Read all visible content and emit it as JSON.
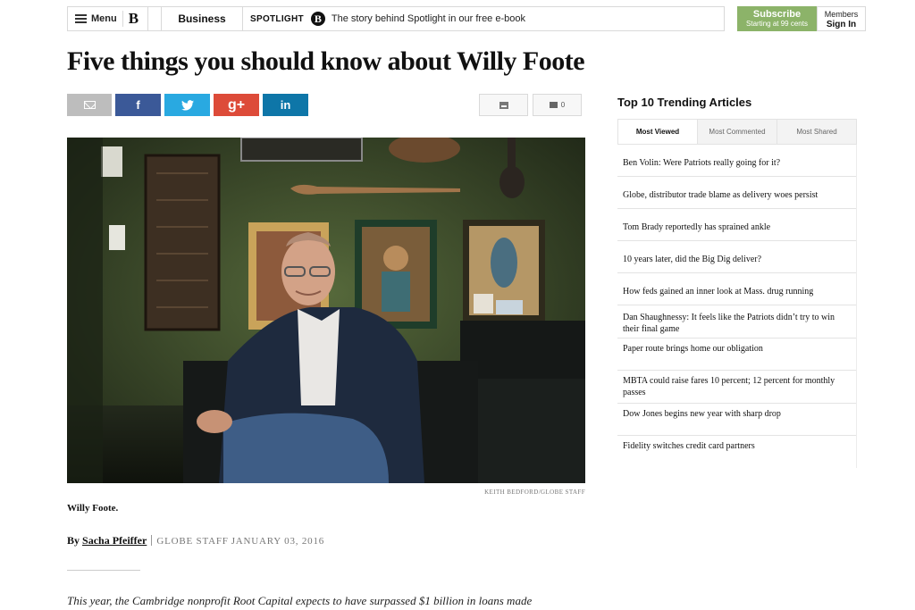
{
  "nav": {
    "menu_label": "Menu",
    "logo": "B",
    "section": "Business",
    "spotlight_label": "SPOTLIGHT",
    "spotlight_logo": "B",
    "spotlight_text": "The story behind Spotlight in our free e-book"
  },
  "subscribe": {
    "label": "Subscribe",
    "sub": "Starting at 99 cents"
  },
  "members": {
    "line1": "Members",
    "line2": "Sign In"
  },
  "article": {
    "headline": "Five things you should know about Willy Foote",
    "photo_credit": "KEITH BEDFORD/GLOBE STAFF",
    "caption": "Willy Foote.",
    "byline_prefix": "By",
    "author": "Sacha Pfeiffer",
    "staff": "GLOBE STAFF",
    "date": "JANUARY 03, 2016",
    "lede": "This year, the Cambridge nonprofit Root Capital expects to have surpassed $1 billion in loans made"
  },
  "share": {
    "facebook": "f",
    "twitter_icon": "twitter-bird",
    "googleplus": "g+",
    "linkedin": "in",
    "comment_count": "0"
  },
  "sidebar": {
    "title": "Top 10 Trending Articles",
    "tabs": [
      "Most Viewed",
      "Most Commented",
      "Most Shared"
    ],
    "items": [
      "Ben Volin: Were Patriots really going for it?",
      "Globe, distributor trade blame as delivery woes persist",
      "Tom Brady reportedly has sprained ankle",
      "10 years later, did the Big Dig deliver?",
      "How feds gained an inner look at Mass. drug running",
      "Dan Shaughnessy: It feels like the Patriots didn’t try to win their final game",
      "Paper route brings home our obligation",
      "MBTA could raise fares 10 percent; 12 percent for monthly passes",
      "Dow Jones begins new year with sharp drop",
      "Fidelity switches credit card partners"
    ]
  },
  "colors": {
    "subscribe_green": "#8cb369",
    "facebook": "#3b5998",
    "twitter": "#29a9e1",
    "googleplus": "#dd4b39",
    "linkedin": "#0e76a8"
  }
}
